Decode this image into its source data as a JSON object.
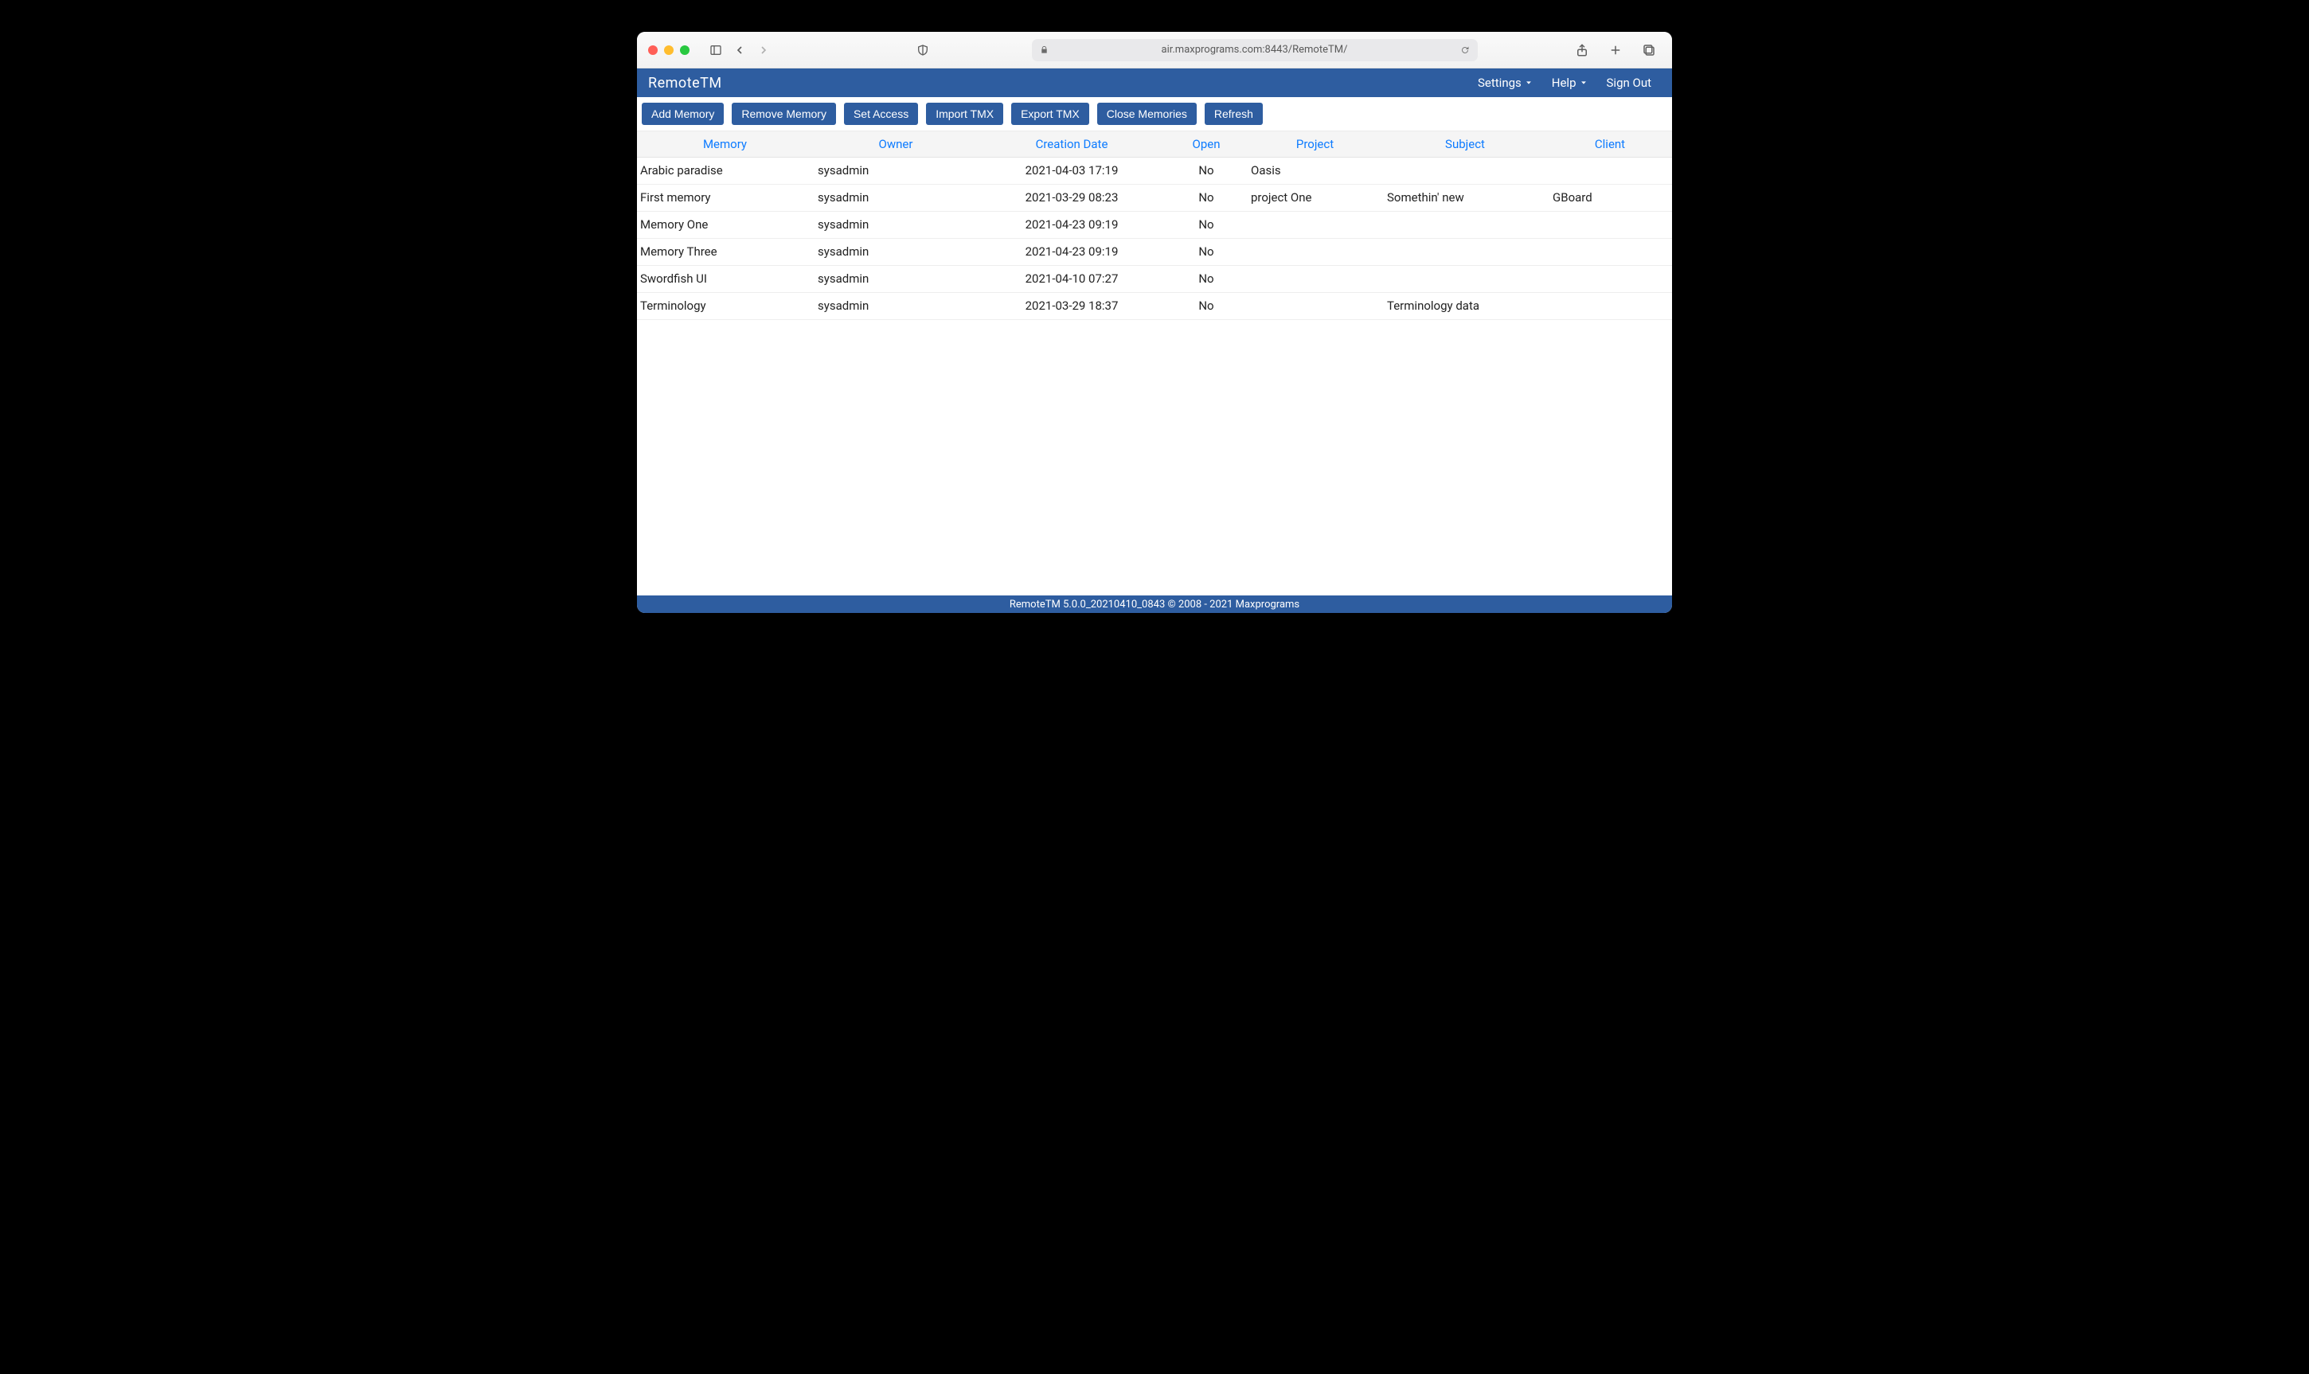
{
  "browser": {
    "url": "air.maxprograms.com:8443/RemoteTM/"
  },
  "app": {
    "title": "RemoteTM",
    "menus": {
      "settings": "Settings",
      "help": "Help",
      "sign_out": "Sign Out"
    }
  },
  "toolbar": {
    "add_memory": "Add Memory",
    "remove_memory": "Remove Memory",
    "set_access": "Set Access",
    "import_tmx": "Import TMX",
    "export_tmx": "Export TMX",
    "close_memories": "Close Memories",
    "refresh": "Refresh"
  },
  "table": {
    "headers": {
      "memory": "Memory",
      "owner": "Owner",
      "creation_date": "Creation Date",
      "open": "Open",
      "project": "Project",
      "subject": "Subject",
      "client": "Client"
    },
    "rows": [
      {
        "memory": "Arabic paradise",
        "owner": "sysadmin",
        "date": "2021-04-03 17:19",
        "open": "No",
        "project": "Oasis",
        "subject": "",
        "client": ""
      },
      {
        "memory": "First memory",
        "owner": "sysadmin",
        "date": "2021-03-29 08:23",
        "open": "No",
        "project": "project One",
        "subject": "Somethin' new",
        "client": "GBoard"
      },
      {
        "memory": "Memory One",
        "owner": "sysadmin",
        "date": "2021-04-23 09:19",
        "open": "No",
        "project": "",
        "subject": "",
        "client": ""
      },
      {
        "memory": "Memory Three",
        "owner": "sysadmin",
        "date": "2021-04-23 09:19",
        "open": "No",
        "project": "",
        "subject": "",
        "client": ""
      },
      {
        "memory": "Swordfish UI",
        "owner": "sysadmin",
        "date": "2021-04-10 07:27",
        "open": "No",
        "project": "",
        "subject": "",
        "client": ""
      },
      {
        "memory": "Terminology",
        "owner": "sysadmin",
        "date": "2021-03-29 18:37",
        "open": "No",
        "project": "",
        "subject": "Terminology data",
        "client": ""
      }
    ]
  },
  "footer": {
    "text": "RemoteTM 5.0.0_20210410_0843 © 2008 - 2021 Maxprograms"
  }
}
